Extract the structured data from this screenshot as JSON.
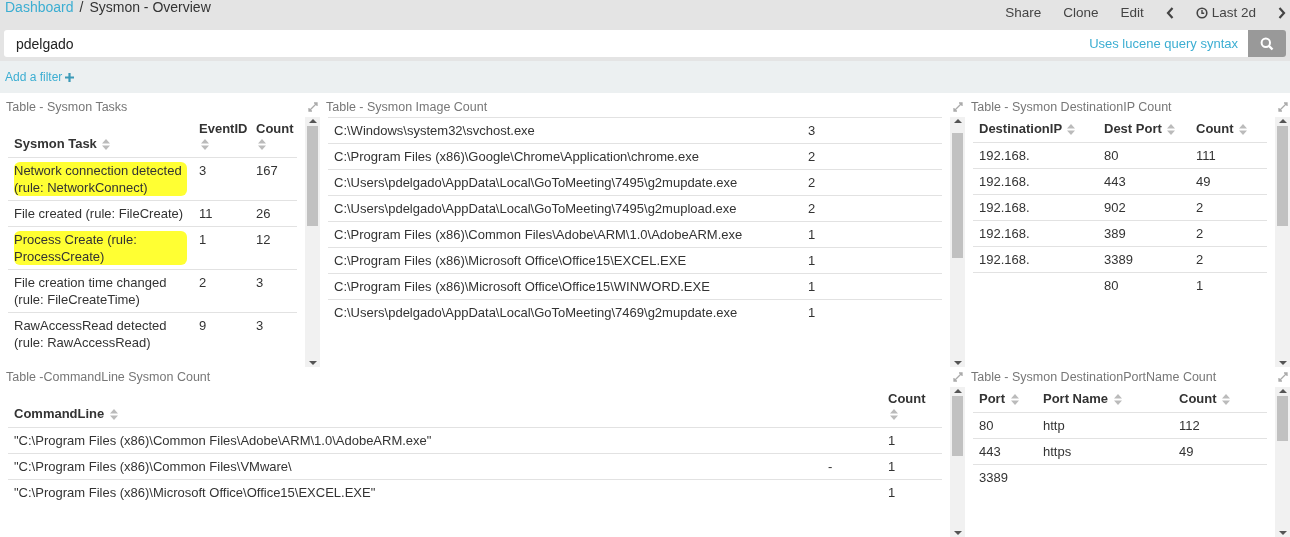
{
  "breadcrumb": {
    "link": "Dashboard",
    "separator": "/",
    "current": "Sysmon - Overview"
  },
  "top_menu": [
    "Share",
    "Clone",
    "Edit"
  ],
  "time_picker": {
    "label": "Last 2d"
  },
  "query": {
    "value": "pdelgado",
    "hint_link": "Uses lucene query syntax"
  },
  "filter_bar": {
    "add_filter": "Add a filter"
  },
  "panels": [
    {
      "title": "Table - Sysmon Tasks",
      "columns": [
        {
          "label": "Sysmon Task",
          "sortable": true
        },
        {
          "label": "EventID",
          "sortable": true
        },
        {
          "label": "Count",
          "sortable": true
        }
      ],
      "rows": [
        {
          "cells": [
            "Network connection detected (rule: NetworkConnect)",
            "3",
            "167"
          ],
          "highlighted": true
        },
        {
          "cells": [
            "File created (rule: FileCreate)",
            "11",
            "26"
          ],
          "highlighted": false
        },
        {
          "cells": [
            "Process Create (rule: ProcessCreate)",
            "1",
            "12"
          ],
          "highlighted": true
        },
        {
          "cells": [
            "File creation time changed (rule: FileCreateTime)",
            "2",
            "3"
          ],
          "highlighted": false
        },
        {
          "cells": [
            "RawAccessRead detected (rule: RawAccessRead)",
            "9",
            "3"
          ],
          "highlighted": false
        }
      ]
    },
    {
      "title": "Table - Sysmon Image Count",
      "rows": [
        {
          "cells": [
            "C:\\Windows\\system32\\svchost.exe",
            "3"
          ]
        },
        {
          "cells": [
            "C:\\Program Files (x86)\\Google\\Chrome\\Application\\chrome.exe",
            "2"
          ]
        },
        {
          "cells": [
            "C:\\Users\\pdelgado\\AppData\\Local\\GoToMeeting\\7495\\g2mupdate.exe",
            "2"
          ]
        },
        {
          "cells": [
            "C:\\Users\\pdelgado\\AppData\\Local\\GoToMeeting\\7495\\g2mupload.exe",
            "2"
          ]
        },
        {
          "cells": [
            "C:\\Program Files (x86)\\Common Files\\Adobe\\ARM\\1.0\\AdobeARM.exe",
            "1"
          ]
        },
        {
          "cells": [
            "C:\\Program Files (x86)\\Microsoft Office\\Office15\\EXCEL.EXE",
            "1"
          ]
        },
        {
          "cells": [
            "C:\\Program Files (x86)\\Microsoft Office\\Office15\\WINWORD.EXE",
            "1"
          ]
        },
        {
          "cells": [
            "C:\\Users\\pdelgado\\AppData\\Local\\GoToMeeting\\7469\\g2mupdate.exe",
            "1"
          ]
        }
      ]
    },
    {
      "title": "Table - Sysmon DestinationIP Count",
      "columns": [
        {
          "label": "DestinationIP",
          "sortable": true
        },
        {
          "label": "Dest Port",
          "sortable": true
        },
        {
          "label": "Count",
          "sortable": true
        }
      ],
      "rows": [
        {
          "cells": [
            "192.168.",
            "80",
            "111"
          ]
        },
        {
          "cells": [
            "192.168.",
            "443",
            "49"
          ]
        },
        {
          "cells": [
            "192.168.",
            "902",
            "2"
          ]
        },
        {
          "cells": [
            "192.168.",
            "389",
            "2"
          ]
        },
        {
          "cells": [
            "192.168.",
            "3389",
            "2"
          ]
        },
        {
          "cells": [
            "",
            "80",
            "1"
          ]
        }
      ]
    },
    {
      "title": "Table -CommandLine Sysmon Count",
      "columns": [
        {
          "label": "CommandLine",
          "sortable": true
        },
        {
          "sortable": false
        },
        {
          "label": "Count",
          "sortable": true
        }
      ],
      "rows": [
        {
          "cells": [
            "\"C:\\Program Files (x86)\\Common Files\\Adobe\\ARM\\1.0\\AdobeARM.exe\"",
            "",
            "1"
          ]
        },
        {
          "cells": [
            "\"C:\\Program Files (x86)\\Common Files\\VMware\\",
            "-",
            "1"
          ]
        },
        {
          "cells": [
            "\"C:\\Program Files (x86)\\Microsoft Office\\Office15\\EXCEL.EXE\"",
            "",
            "1"
          ]
        }
      ]
    },
    {
      "title": "Table - Sysmon DestinationPortName Count",
      "columns": [
        {
          "label": "Port",
          "sortable": true
        },
        {
          "label": "Port Name",
          "sortable": true
        },
        {
          "label": "Count",
          "sortable": true
        }
      ],
      "rows": [
        {
          "cells": [
            "80",
            "http",
            "112"
          ]
        },
        {
          "cells": [
            "443",
            "https",
            "49"
          ]
        },
        {
          "cells": [
            "3389",
            "",
            ""
          ]
        }
      ]
    }
  ]
}
